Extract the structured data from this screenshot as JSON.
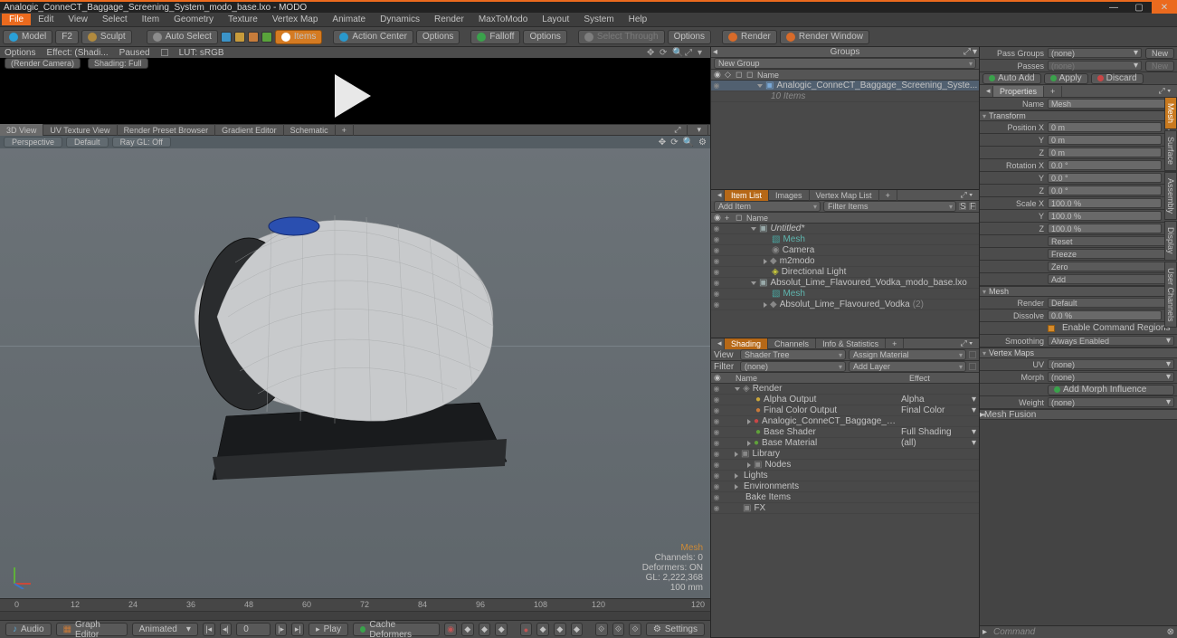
{
  "title": "Analogic_ConneCT_Baggage_Screening_System_modo_base.lxo - MODO",
  "menu": [
    "File",
    "Edit",
    "View",
    "Select",
    "Item",
    "Geometry",
    "Texture",
    "Vertex Map",
    "Animate",
    "Dynamics",
    "Render",
    "MaxToModo",
    "Layout",
    "System",
    "Help"
  ],
  "toolbar": {
    "model": "Model",
    "sculpt": "Sculpt",
    "autoselect": "Auto Select",
    "items": "Items",
    "actioncenter": "Action Center",
    "options": "Options",
    "falloff": "Falloff",
    "options2": "Options",
    "selthrough": "Select Through",
    "options3": "Options",
    "render": "Render",
    "renderwin": "Render Window",
    "f2": "F2"
  },
  "preview": {
    "options": "Options",
    "effect": "Effect: (Shadi...",
    "paused": "Paused",
    "lut": "LUT: sRGB",
    "rendercam": "(Render Camera)",
    "shading": "Shading: Full"
  },
  "viewtabs": [
    "3D View",
    "UV Texture View",
    "Render Preset Browser",
    "Gradient Editor",
    "Schematic",
    "+"
  ],
  "vpbar": {
    "perspective": "Perspective",
    "default": "Default",
    "raygl": "Ray GL: Off"
  },
  "stats": {
    "mesh": "Mesh",
    "channels": "Channels: 0",
    "deformers": "Deformers: ON",
    "gl": "GL: 2,222,368",
    "mm": "100 mm"
  },
  "timeline": {
    "t0": "0",
    "t24": "24",
    "t48": "48",
    "t72": "72",
    "t96": "96",
    "t120": "120",
    "t12": "12",
    "t36": "36",
    "t60": "60",
    "t84": "84",
    "t108": "108"
  },
  "play": {
    "audio": "Audio",
    "graph": "Graph Editor",
    "animated": "Animated",
    "frame": "0",
    "play": "Play",
    "cache": "Cache Deformers",
    "settings": "Settings"
  },
  "groups": {
    "title": "Groups",
    "newgroup": "New Group",
    "nameh": "Name",
    "item": "Analogic_ConneCT_Baggage_Screening_Syste...",
    "sub": "10 Items"
  },
  "itemlist": {
    "tabs": [
      "Item List",
      "Images",
      "Vertex Map List",
      "+"
    ],
    "additem": "Add Item",
    "filteritems": "Filter Items",
    "nameh": "Name",
    "sf": "S",
    "ff": "F",
    "rows": [
      {
        "indent": 0,
        "exp": "d",
        "icon": "file",
        "label": "Untitled*",
        "ital": true
      },
      {
        "indent": 1,
        "exp": "",
        "icon": "mesh",
        "label": "Mesh",
        "teal": true
      },
      {
        "indent": 1,
        "exp": "",
        "icon": "cam",
        "label": "Camera"
      },
      {
        "indent": 1,
        "exp": "r",
        "icon": "dot",
        "label": "m2modo"
      },
      {
        "indent": 1,
        "exp": "",
        "icon": "light",
        "label": "Directional Light"
      },
      {
        "indent": 0,
        "exp": "d",
        "icon": "file",
        "label": "Absolut_Lime_Flavoured_Vodka_modo_base.lxo"
      },
      {
        "indent": 1,
        "exp": "",
        "icon": "mesh",
        "label": "Mesh",
        "teal": true
      },
      {
        "indent": 1,
        "exp": "r",
        "icon": "dot",
        "label": "Absolut_Lime_Flavoured_Vodka",
        "count": "(2)"
      }
    ]
  },
  "shading": {
    "tabs": [
      "Shading",
      "Channels",
      "Info & Statistics",
      "+"
    ],
    "viewlbl": "View",
    "viewsel": "Shader Tree",
    "assign": "Assign Material",
    "filterlbl": "Filter",
    "filtersel": "(none)",
    "addlayer": "Add Layer",
    "nameh": "Name",
    "effecth": "Effect",
    "rows": [
      {
        "indent": 0,
        "exp": "d",
        "icon": "ren",
        "label": "Render",
        "effect": ""
      },
      {
        "indent": 1,
        "exp": "",
        "icon": "oy",
        "label": "Alpha Output",
        "effect": "Alpha"
      },
      {
        "indent": 1,
        "exp": "",
        "icon": "or",
        "label": "Final Color Output",
        "effect": "Final Color"
      },
      {
        "indent": 1,
        "exp": "r",
        "icon": "rd",
        "label": "Analogic_ConneCT_Baggage_Screenin ...",
        "effect": ""
      },
      {
        "indent": 1,
        "exp": "",
        "icon": "gr",
        "label": "Base Shader",
        "effect": "Full Shading"
      },
      {
        "indent": 1,
        "exp": "r",
        "icon": "gr",
        "label": "Base Material",
        "effect": "(all)"
      },
      {
        "indent": 0,
        "exp": "r",
        "icon": "fo",
        "label": "Library",
        "effect": ""
      },
      {
        "indent": 1,
        "exp": "r",
        "icon": "fo",
        "label": "Nodes",
        "effect": ""
      },
      {
        "indent": 0,
        "exp": "r",
        "icon": "",
        "label": "Lights",
        "effect": ""
      },
      {
        "indent": 0,
        "exp": "r",
        "icon": "",
        "label": "Environments",
        "effect": ""
      },
      {
        "indent": 0,
        "exp": "",
        "icon": "",
        "label": "Bake Items",
        "effect": ""
      },
      {
        "indent": 0,
        "exp": "",
        "icon": "fx",
        "label": "FX",
        "effect": ""
      }
    ]
  },
  "props": {
    "passgroups": "Pass Groups",
    "passsel": "(none)",
    "new": "New",
    "passes": "Passes",
    "passsel2": "(none)",
    "new2": "New",
    "autoadd": "Auto Add",
    "apply": "Apply",
    "discard": "Discard",
    "proptab": "Properties",
    "plus": "+",
    "namelbl": "Name",
    "nameval": "Mesh",
    "transform": "Transform",
    "posx": "Position X",
    "posxval": "0 m",
    "posyval": "0 m",
    "poszval": "0 m",
    "Y": "Y",
    "Z": "Z",
    "rotx": "Rotation X",
    "rotxval": "0.0 °",
    "rotyval": "0.0 °",
    "rotzval": "0.0 °",
    "sclx": "Scale X",
    "sclxval": "100.0 %",
    "sclyval": "100.0 %",
    "sclzval": "100.0 %",
    "reset": "Reset",
    "freeze": "Freeze",
    "zero": "Zero",
    "add": "Add",
    "mesh": "Mesh",
    "renderlbl": "Render",
    "renderval": "Default",
    "dissolve": "Dissolve",
    "dissolveval": "0.0 %",
    "enablecmd": "Enable Command Regions",
    "smoothing": "Smoothing",
    "smoothval": "Always Enabled",
    "vmaps": "Vertex Maps",
    "uvlbl": "UV",
    "uvval": "(none)",
    "morphlbl": "Morph",
    "morphval": "(none)",
    "addmorph": "Add Morph Influence",
    "weightlbl": "Weight",
    "weightval": "(none)",
    "meshfusion": "Mesh Fusion",
    "cmdlbl": "Command"
  },
  "sidetabs": [
    "Mesh",
    "Surface",
    "Assembly",
    "Display",
    "User Channels"
  ]
}
